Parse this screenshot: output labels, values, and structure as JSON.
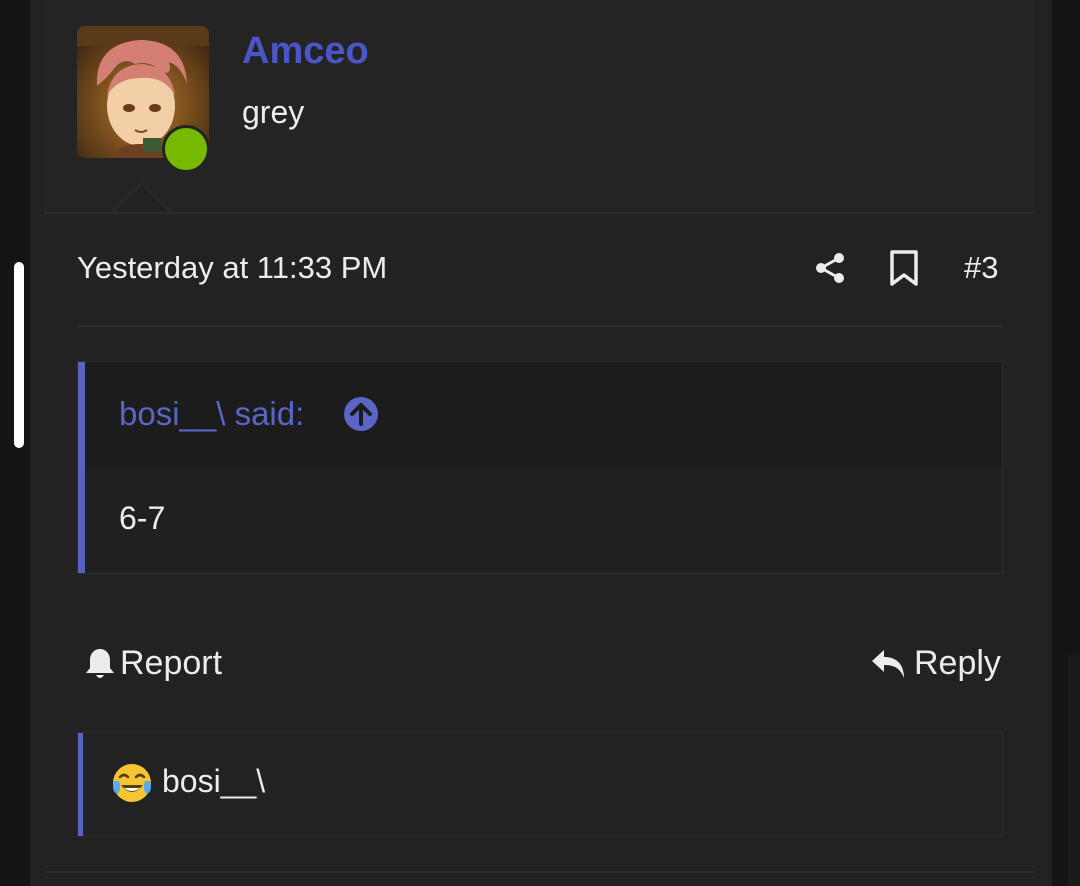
{
  "post": {
    "username": "Amceo",
    "user_title": "grey",
    "timestamp": "Yesterday at 11:33 PM",
    "post_number": "#3",
    "quote": {
      "author": "bosi__\\ said:",
      "body": "6-7"
    },
    "actions": {
      "report_label": "Report",
      "reply_label": "Reply"
    },
    "reactions": {
      "user": "bosi__\\",
      "emoji": "face-with-tears-of-joy"
    }
  },
  "colors": {
    "username": "#4a56c8",
    "quote_accent": "#5863c0",
    "online": "#76b900"
  }
}
